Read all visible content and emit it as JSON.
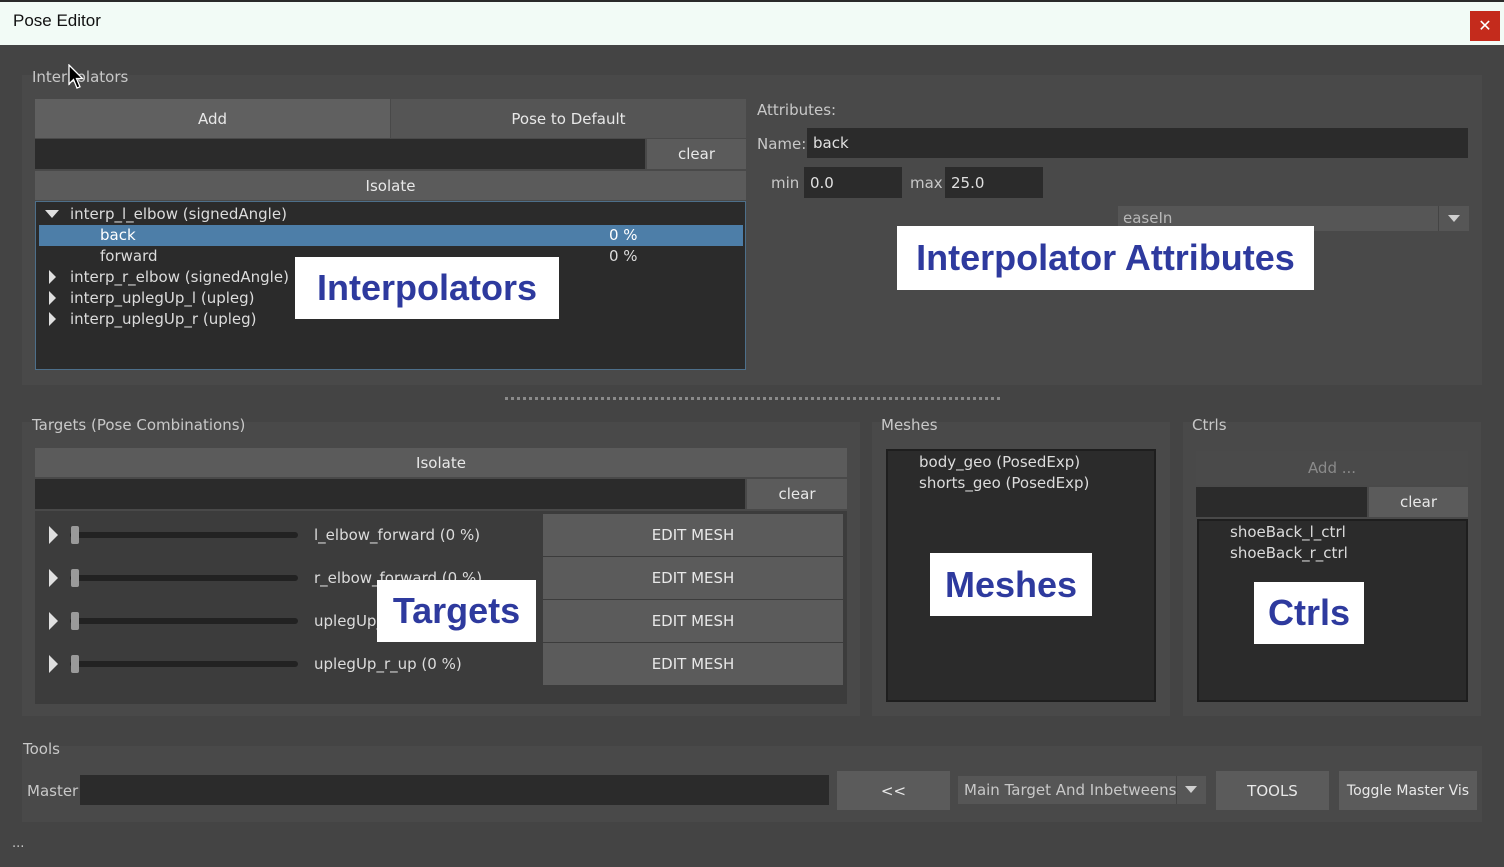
{
  "window": {
    "title": "Pose Editor",
    "close_glyph": "✕"
  },
  "interpolators": {
    "group_label": "Interpolators",
    "add_label": "Add",
    "pose_default_label": "Pose to Default",
    "filter_value": "",
    "clear_label": "clear",
    "isolate_label": "Isolate",
    "tree": [
      {
        "label": "interp_l_elbow (signedAngle)",
        "expanded": true
      },
      {
        "label": "back",
        "value": "0 %",
        "selected": true
      },
      {
        "label": "forward",
        "value": "0 %"
      },
      {
        "label": "interp_r_elbow (signedAngle)",
        "expanded": false
      },
      {
        "label": "interp_uplegUp_l (upleg)",
        "expanded": false
      },
      {
        "label": "interp_uplegUp_r (upleg)",
        "expanded": false
      }
    ],
    "overlay": "Interpolators"
  },
  "attributes": {
    "section_label": "Attributes:",
    "name_label": "Name:",
    "name_value": "back",
    "min_label": "min",
    "min_value": "0.0",
    "max_label": "max",
    "max_value": "25.0",
    "interp_type": "easeIn",
    "overlay": "Interpolator Attributes"
  },
  "targets": {
    "group_label": "Targets (Pose Combinations)",
    "isolate_label": "Isolate",
    "filter_value": "",
    "clear_label": "clear",
    "rows": [
      {
        "label": "l_elbow_forward (0 %)",
        "edit": "EDIT MESH",
        "slider": 0
      },
      {
        "label": "r_elbow_forward (0 %)",
        "edit": "EDIT MESH",
        "slider": 0
      },
      {
        "label": "uplegUp_l_up (0 %)",
        "edit": "EDIT MESH",
        "slider": 0
      },
      {
        "label": "uplegUp_r_up (0 %)",
        "edit": "EDIT MESH",
        "slider": 0
      }
    ],
    "overlay": "Targets"
  },
  "meshes": {
    "group_label": "Meshes",
    "items": [
      "body_geo (PosedExp)",
      "shorts_geo (PosedExp)"
    ],
    "overlay": "Meshes"
  },
  "ctrls": {
    "group_label": "Ctrls",
    "add_label": "Add ...",
    "filter_value": "",
    "clear_label": "clear",
    "items": [
      "shoeBack_l_ctrl",
      "shoeBack_r_ctrl"
    ],
    "overlay": "Ctrls"
  },
  "tools": {
    "group_label": "Tools",
    "master_label": "Master",
    "master_value": "",
    "back_label": "<<",
    "mode_value": "Main Target And Inbetweens",
    "tools_label": "TOOLS",
    "toggle_label": "Toggle Master Vis"
  },
  "status": {
    "text": "..."
  },
  "colors": {
    "selection": "#4d7ea8",
    "overlay_text": "#2e3a9e",
    "close": "#c42b1c"
  }
}
